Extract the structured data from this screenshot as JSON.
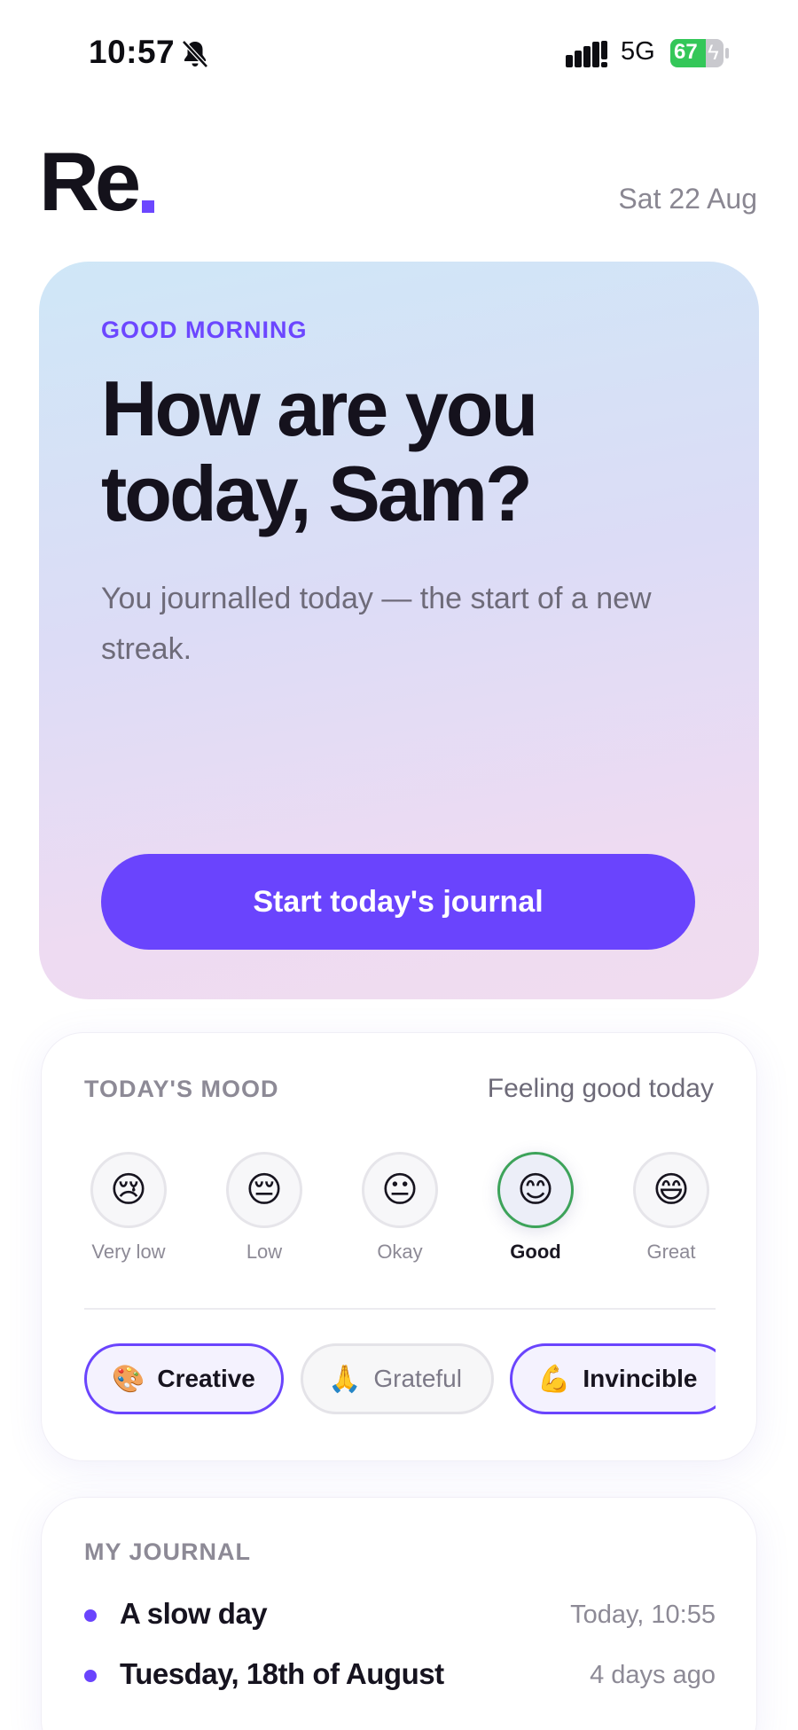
{
  "status_bar": {
    "time": "10:57",
    "network": "5G",
    "battery_percent": "67",
    "battery_level": 0.67,
    "icons": [
      "bell-slash-icon",
      "signal-icon",
      "battery-charging-icon"
    ]
  },
  "header": {
    "logo": "Re",
    "date": "Sat 22 Aug"
  },
  "hero": {
    "greeting": "GOOD MORNING",
    "title": "How are you today, Sam?",
    "subtitle": "You journalled today — the start of a new streak.",
    "cta_label": "Start today's journal"
  },
  "mood": {
    "label": "TODAY'S MOOD",
    "status": "Feeling good today",
    "selected": "Good",
    "options": [
      {
        "emoji": "😢",
        "label": "Very low"
      },
      {
        "emoji": "😔",
        "label": "Low"
      },
      {
        "emoji": "😐",
        "label": "Okay"
      },
      {
        "emoji": "😊",
        "label": "Good"
      },
      {
        "emoji": "😄",
        "label": "Great"
      }
    ],
    "tags": [
      {
        "emoji": "🎨",
        "label": "Creative",
        "selected": true
      },
      {
        "emoji": "🙏",
        "label": "Grateful",
        "selected": false
      },
      {
        "emoji": "💪",
        "label": "Invincible",
        "selected": true
      }
    ]
  },
  "journal": {
    "label": "MY JOURNAL",
    "entries": [
      {
        "title": "A slow day",
        "time": "Today, 10:55"
      },
      {
        "title": "Tuesday, 18th of August",
        "time": "4 days ago"
      }
    ]
  },
  "colors": {
    "accent": "#6a44fd",
    "selected_ring": "#3da35a",
    "battery": "#34c759"
  }
}
